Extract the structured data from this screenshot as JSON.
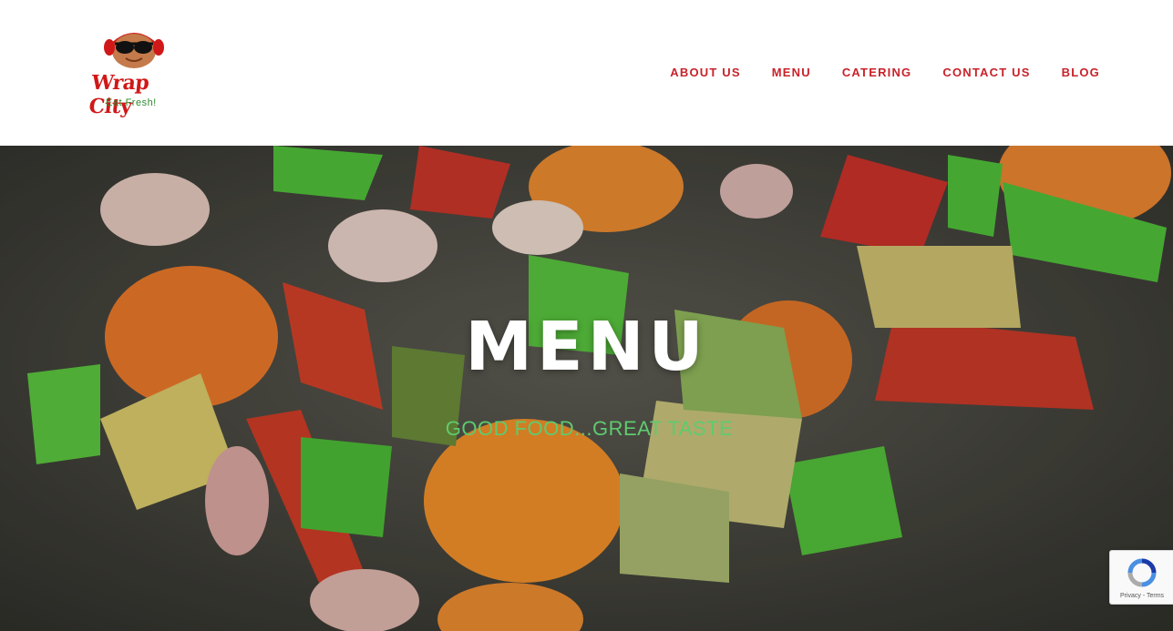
{
  "brand": {
    "name": "Wrap City",
    "tagline": "Eat Fresh!"
  },
  "nav": {
    "items": [
      {
        "label": "ABOUT US"
      },
      {
        "label": "MENU"
      },
      {
        "label": "CATERING"
      },
      {
        "label": "CONTACT US"
      },
      {
        "label": "BLOG"
      }
    ]
  },
  "hero": {
    "title": "MENU",
    "subtitle": "GOOD FOOD...GREAT TASTE"
  },
  "recaptcha": {
    "privacy": "Privacy",
    "separator": " - ",
    "terms": "Terms"
  },
  "colors": {
    "nav": "#c8222a",
    "subtitle": "#5ecb6e",
    "title": "#ffffff",
    "logo_red": "#d01818",
    "logo_green": "#2f8a2f"
  }
}
